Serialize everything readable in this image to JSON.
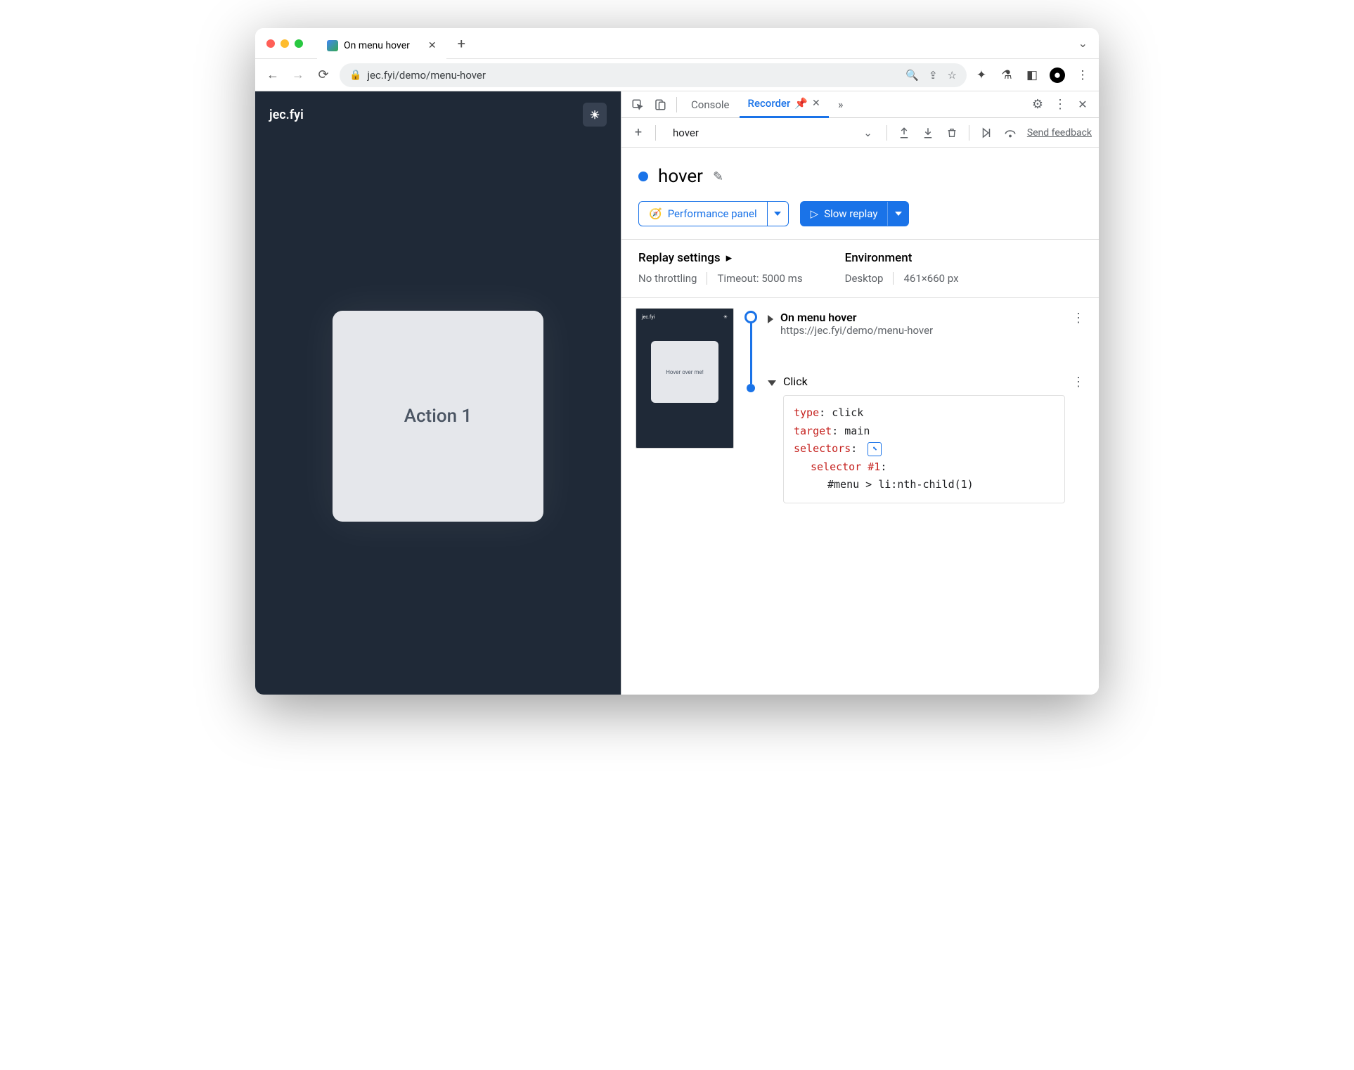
{
  "tab": {
    "title": "On menu hover"
  },
  "url": "jec.fyi/demo/menu-hover",
  "page": {
    "brand": "jec.fyi",
    "card": "Action 1"
  },
  "devtools": {
    "tabs": {
      "console": "Console",
      "recorder": "Recorder"
    },
    "toolbar": {
      "recording_name": "hover",
      "send_feedback": "Send feedback"
    },
    "rec_header": {
      "title": "hover",
      "perf_btn": "Performance panel",
      "replay_btn": "Slow replay"
    },
    "settings": {
      "replay_h": "Replay settings",
      "throttling": "No throttling",
      "timeout": "Timeout: 5000 ms",
      "env_h": "Environment",
      "env_device": "Desktop",
      "env_size": "461×660 px"
    },
    "steps": {
      "step1": {
        "title": "On menu hover",
        "url": "https://jec.fyi/demo/menu-hover"
      },
      "step2": {
        "title": "Click",
        "type_k": "type",
        "type_v": "click",
        "target_k": "target",
        "target_v": "main",
        "selectors_k": "selectors",
        "sel_label": "selector #1",
        "sel_val": "#menu > li:nth-child(1)"
      },
      "thumb": {
        "brand": "jec.fyi",
        "card": "Hover over me!"
      }
    }
  }
}
